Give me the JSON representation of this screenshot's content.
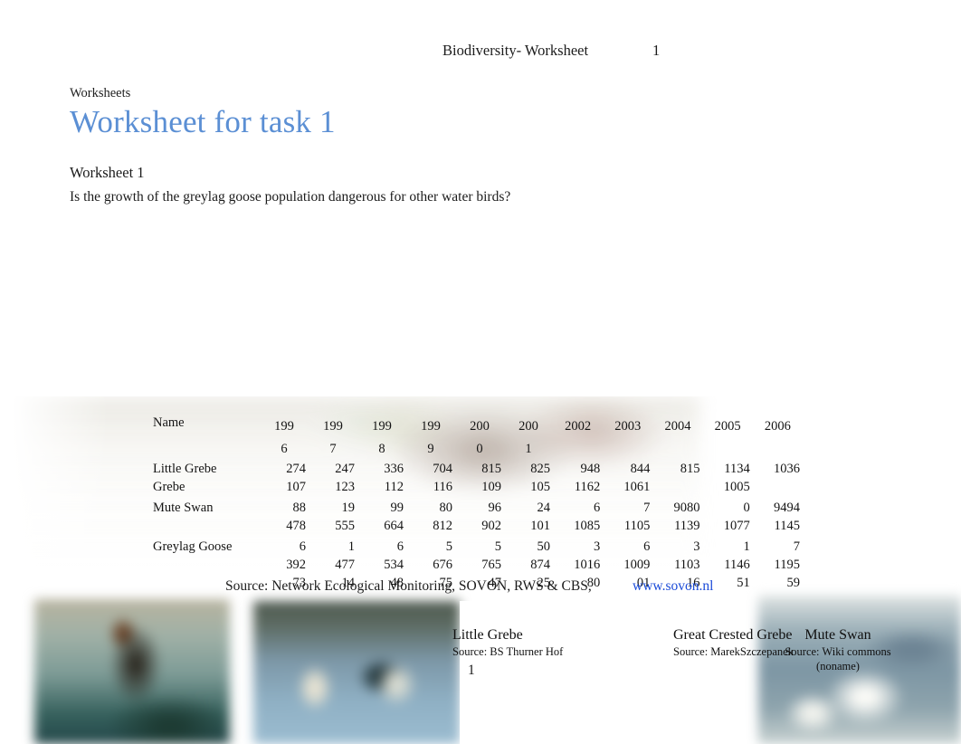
{
  "header": {
    "title": "Biodiversity- Worksheet",
    "page_number": "1"
  },
  "title_block": {
    "breadcrumb": "Worksheets",
    "page_title": "Worksheet for task 1"
  },
  "worksheet": {
    "label": "Worksheet 1",
    "question": "Is the growth of the greylag goose population dangerous for other water birds?"
  },
  "table": {
    "name_header": "Name",
    "year_headers": [
      "199\n6",
      "199\n7",
      "199\n8",
      "199\n9",
      "200\n0",
      "200\n1",
      "2002",
      "2003",
      "2004",
      "2005",
      "2006"
    ],
    "years": [
      "1996",
      "1997",
      "1998",
      "1999",
      "2000",
      "2001",
      "2002",
      "2003",
      "2004",
      "2005",
      "2006"
    ],
    "rows": [
      {
        "name": "Little Grebe\nGrebe",
        "name_lines": [
          "Little Grebe",
          "Grebe"
        ],
        "values": [
          "274\n107",
          "247\n123",
          "336\n112",
          "704\n116",
          "815\n109",
          "825\n105",
          "948\n1162",
          "844\n1061",
          "815",
          "1134\n1005",
          "1036"
        ]
      },
      {
        "name": "Mute Swan",
        "name_lines": [
          "",
          "Mute Swan"
        ],
        "values": [
          "88\n478",
          "19\n555",
          "99\n664",
          "80\n812",
          "96\n902",
          "24\n101",
          "6\n1085",
          "7\n1105",
          "9080\n1139",
          "0\n1077",
          "9494\n1145"
        ]
      },
      {
        "name": "Greylag Goose",
        "name_lines": [
          "",
          "Greylag Goose",
          ""
        ],
        "values": [
          "6\n392\n73",
          "1\n477\n14",
          "6\n534\n48",
          "5\n676\n75",
          "5\n765\n47",
          "50\n874\n25",
          "3\n1016\n80",
          "6\n1009\n01",
          "3\n1103\n16",
          "1\n1146\n51",
          "7\n1195\n59"
        ]
      }
    ]
  },
  "source": {
    "text": "Source: Network Ecological Monitoring, SOVON, RWS & CBS,",
    "link_label": "www.sovon.nl"
  },
  "captions": [
    {
      "title": "Little Grebe",
      "source": "Source: BS Thurner Hof"
    },
    {
      "title": "Great Crested Grebe",
      "source": "Source: MarekSzczepanek"
    },
    {
      "title": "Mute Swan",
      "source": "Source: Wiki commons (noname)"
    }
  ],
  "footer": {
    "page_number": "1"
  },
  "colors": {
    "title_blue": "#5b8fd4",
    "link_blue": "#1b4bd8",
    "text": "#1a1a1a",
    "background": "#ffffff"
  }
}
